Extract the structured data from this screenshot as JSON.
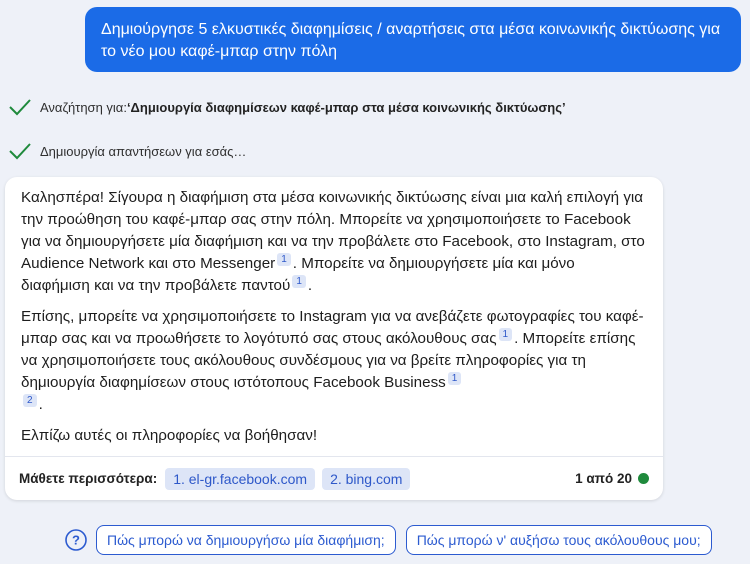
{
  "user_message": "Δημιούργησε 5 ελκυστικές διαφημίσεις / αναρτήσεις στα μέσα κοινωνικής δικτύωσης για το νέο μου καφέ-μπαρ στην πόλη",
  "status": {
    "search_prefix": "Αναζήτηση για: ",
    "search_query": "‘Δημιουργία διαφημίσεων καφέ-μπαρ στα μέσα κοινωνικής δικτύωσης’",
    "generating": "Δημιουργία απαντήσεων για εσάς…"
  },
  "answer": {
    "p1_a": "Καλησπέρα! Σίγουρα η διαφήμιση στα μέσα κοινωνικής δικτύωσης είναι μια καλή επιλογή για την προώθηση του καφέ-μπαρ σας στην πόλη. Μπορείτε να χρησιμοποιήσετε το Facebook για να δημιουργήσετε μία διαφήμιση και να την προβάλετε στο Facebook, στο Instagram, στο Audience Network και στο Messenger",
    "p1_cite1": "1",
    "p1_b": ". Μπορείτε να δημιουργήσετε μία και μόνο διαφήμιση και να την προβάλετε παντού",
    "p1_cite2": "1",
    "p1_c": ".",
    "p2_a": "Επίσης, μπορείτε να χρησιμοποιήσετε το Instagram για να ανεβάζετε φωτογραφίες του καφέ-μπαρ σας και να προωθήσετε το λογότυπό σας στους ακόλουθους σας",
    "p2_cite1": "1",
    "p2_b": ". Μπορείτε επίσης να χρησιμοποιήσετε τους ακόλουθους συνδέσμους για να βρείτε πληροφορίες για τη δημιουργία διαφημίσεων στους ιστότοπους Facebook Business",
    "p2_cite2": "1",
    "p2_cite3": "2",
    "p2_c": ".",
    "p3": "Ελπίζω αυτές οι πληροφορίες να βοήθησαν!"
  },
  "learn_more": {
    "label": "Μάθετε περισσότερα:",
    "sources": [
      "1. el-gr.facebook.com",
      "2. bing.com"
    ],
    "counter": "1 από 20",
    "status_color": "#1f8a3c"
  },
  "suggestions": [
    "Πώς μπορώ να δημιουργήσω μία διαφήμιση;",
    "Πώς μπορώ ν' αυξήσω τους ακόλουθους μου;"
  ],
  "icons": {
    "status": "check-icon",
    "help": "question-circle-icon"
  },
  "colors": {
    "accent": "#1b6be7",
    "link": "#2c5bd0",
    "check": "#1f8a3c"
  }
}
